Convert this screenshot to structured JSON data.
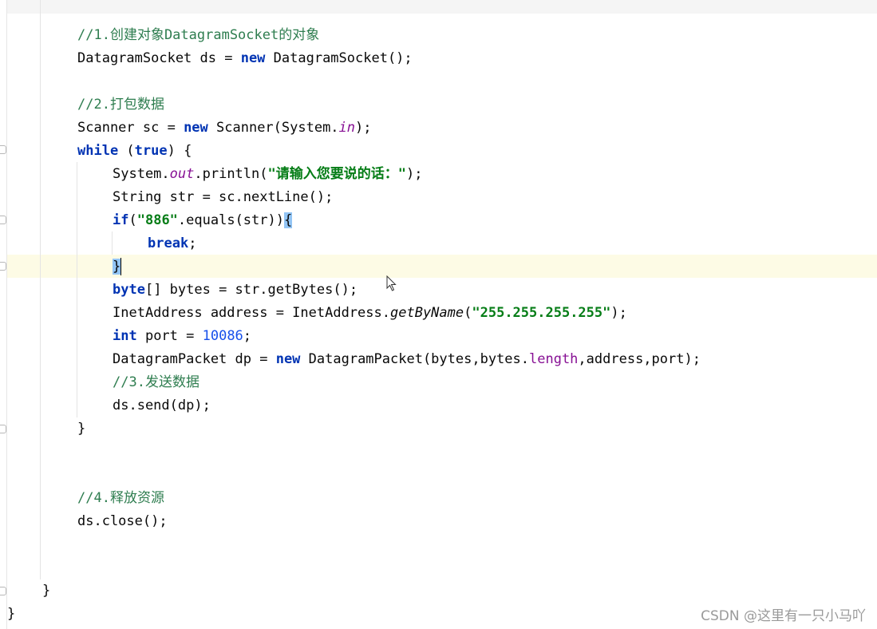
{
  "editor": {
    "lines": [
      [
        {
          "t": "//1.创建对象DatagramSocket的对象",
          "c": "cm"
        }
      ],
      [
        {
          "t": "DatagramSocket ds = "
        },
        {
          "t": "new",
          "c": "kw"
        },
        {
          "t": " DatagramSocket();"
        }
      ],
      [],
      [
        {
          "t": "//2.打包数据",
          "c": "cm"
        }
      ],
      [
        {
          "t": "Scanner sc = "
        },
        {
          "t": "new",
          "c": "kw"
        },
        {
          "t": " Scanner(System."
        },
        {
          "t": "in",
          "c": "fld"
        },
        {
          "t": ");"
        }
      ],
      [
        {
          "t": "while",
          "c": "kw"
        },
        {
          "t": " ("
        },
        {
          "t": "true",
          "c": "kw"
        },
        {
          "t": ") {"
        }
      ],
      [
        {
          "t": "System."
        },
        {
          "t": "out",
          "c": "fld"
        },
        {
          "t": ".println("
        },
        {
          "t": "\"请输入您要说的话：\"",
          "c": "str"
        },
        {
          "t": ");"
        }
      ],
      [
        {
          "t": "String str = sc.nextLine();"
        }
      ],
      [
        {
          "t": "if",
          "c": "kw"
        },
        {
          "t": "("
        },
        {
          "t": "\"886\"",
          "c": "str"
        },
        {
          "t": ".equals(str))"
        },
        {
          "t": "{",
          "c": "brace-hl"
        }
      ],
      [
        {
          "t": "break",
          "c": "kw"
        },
        {
          "t": ";"
        }
      ],
      [
        {
          "t": "}",
          "c": "brace-hl"
        }
      ],
      [
        {
          "t": "byte",
          "c": "kw"
        },
        {
          "t": "[] bytes = str.getBytes();"
        }
      ],
      [
        {
          "t": "InetAddress address = InetAddress."
        },
        {
          "t": "getByName",
          "c": "ital"
        },
        {
          "t": "("
        },
        {
          "t": "\"255.255.255.255\"",
          "c": "str"
        },
        {
          "t": ");"
        }
      ],
      [
        {
          "t": "int",
          "c": "kw"
        },
        {
          "t": " port = "
        },
        {
          "t": "10086",
          "c": "num"
        },
        {
          "t": ";"
        }
      ],
      [
        {
          "t": "DatagramPacket dp = "
        },
        {
          "t": "new",
          "c": "kw"
        },
        {
          "t": " DatagramPacket(bytes,bytes."
        },
        {
          "t": "length",
          "c": "fld2"
        },
        {
          "t": ",address,port);"
        }
      ],
      [
        {
          "t": "//3.发送数据",
          "c": "cm"
        }
      ],
      [
        {
          "t": "ds.send(dp);"
        }
      ],
      [
        {
          "t": "}"
        }
      ],
      [],
      [],
      [
        {
          "t": "//4.释放资源",
          "c": "cm"
        }
      ],
      [
        {
          "t": "ds.close();"
        }
      ],
      [],
      [],
      [
        {
          "t": "}"
        }
      ],
      [
        {
          "t": "}"
        }
      ]
    ]
  },
  "watermark": "CSDN @这里有一只小马吖"
}
